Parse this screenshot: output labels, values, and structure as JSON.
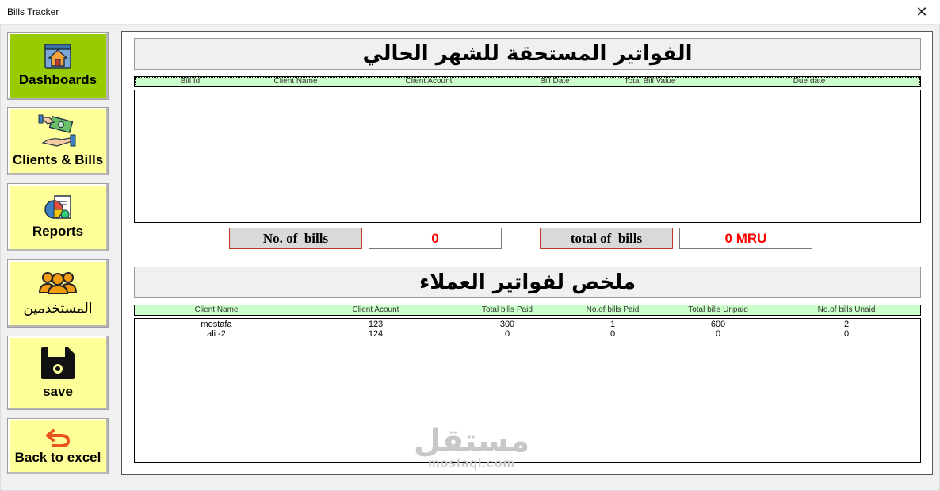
{
  "window": {
    "title": "Bills Tracker",
    "close_glyph": "✕"
  },
  "nav": {
    "dashboards": "Dashboards",
    "clients_bills": "Clients & Bills",
    "reports": "Reports",
    "users": "المستخدمين",
    "save": "save",
    "back": "Back to excel"
  },
  "due_section": {
    "title": "الفواتير المستحقة للشهر الحالي",
    "columns": [
      "Bill Id",
      "Client Name",
      "Client Acount",
      "Bill Date",
      "Total Bill Value",
      "Due date"
    ],
    "rows": []
  },
  "stats": {
    "bills_count_label": "No. of  bills",
    "bills_count_value": "0",
    "total_label": "total of  bills",
    "total_value": "0 MRU"
  },
  "summary_section": {
    "title": "ملخص لفواتير العملاء",
    "columns": [
      "Client Name",
      "Client Acount",
      "Total bills Paid",
      "No.of bills Paid",
      "Total bills Unpaid",
      "No.of bills Unaid"
    ],
    "rows": [
      [
        "mostafa",
        "123",
        "300",
        "1",
        "600",
        "2"
      ],
      [
        "ali -2",
        "124",
        "0",
        "0",
        "0",
        "0"
      ]
    ]
  },
  "watermark": {
    "arabic": "مستقل",
    "latin": "mostaql.com"
  },
  "colors": {
    "active_nav": "#99cc00",
    "nav": "#ffff99",
    "header_row": "#ccffcc",
    "value_red": "#ff0000"
  }
}
